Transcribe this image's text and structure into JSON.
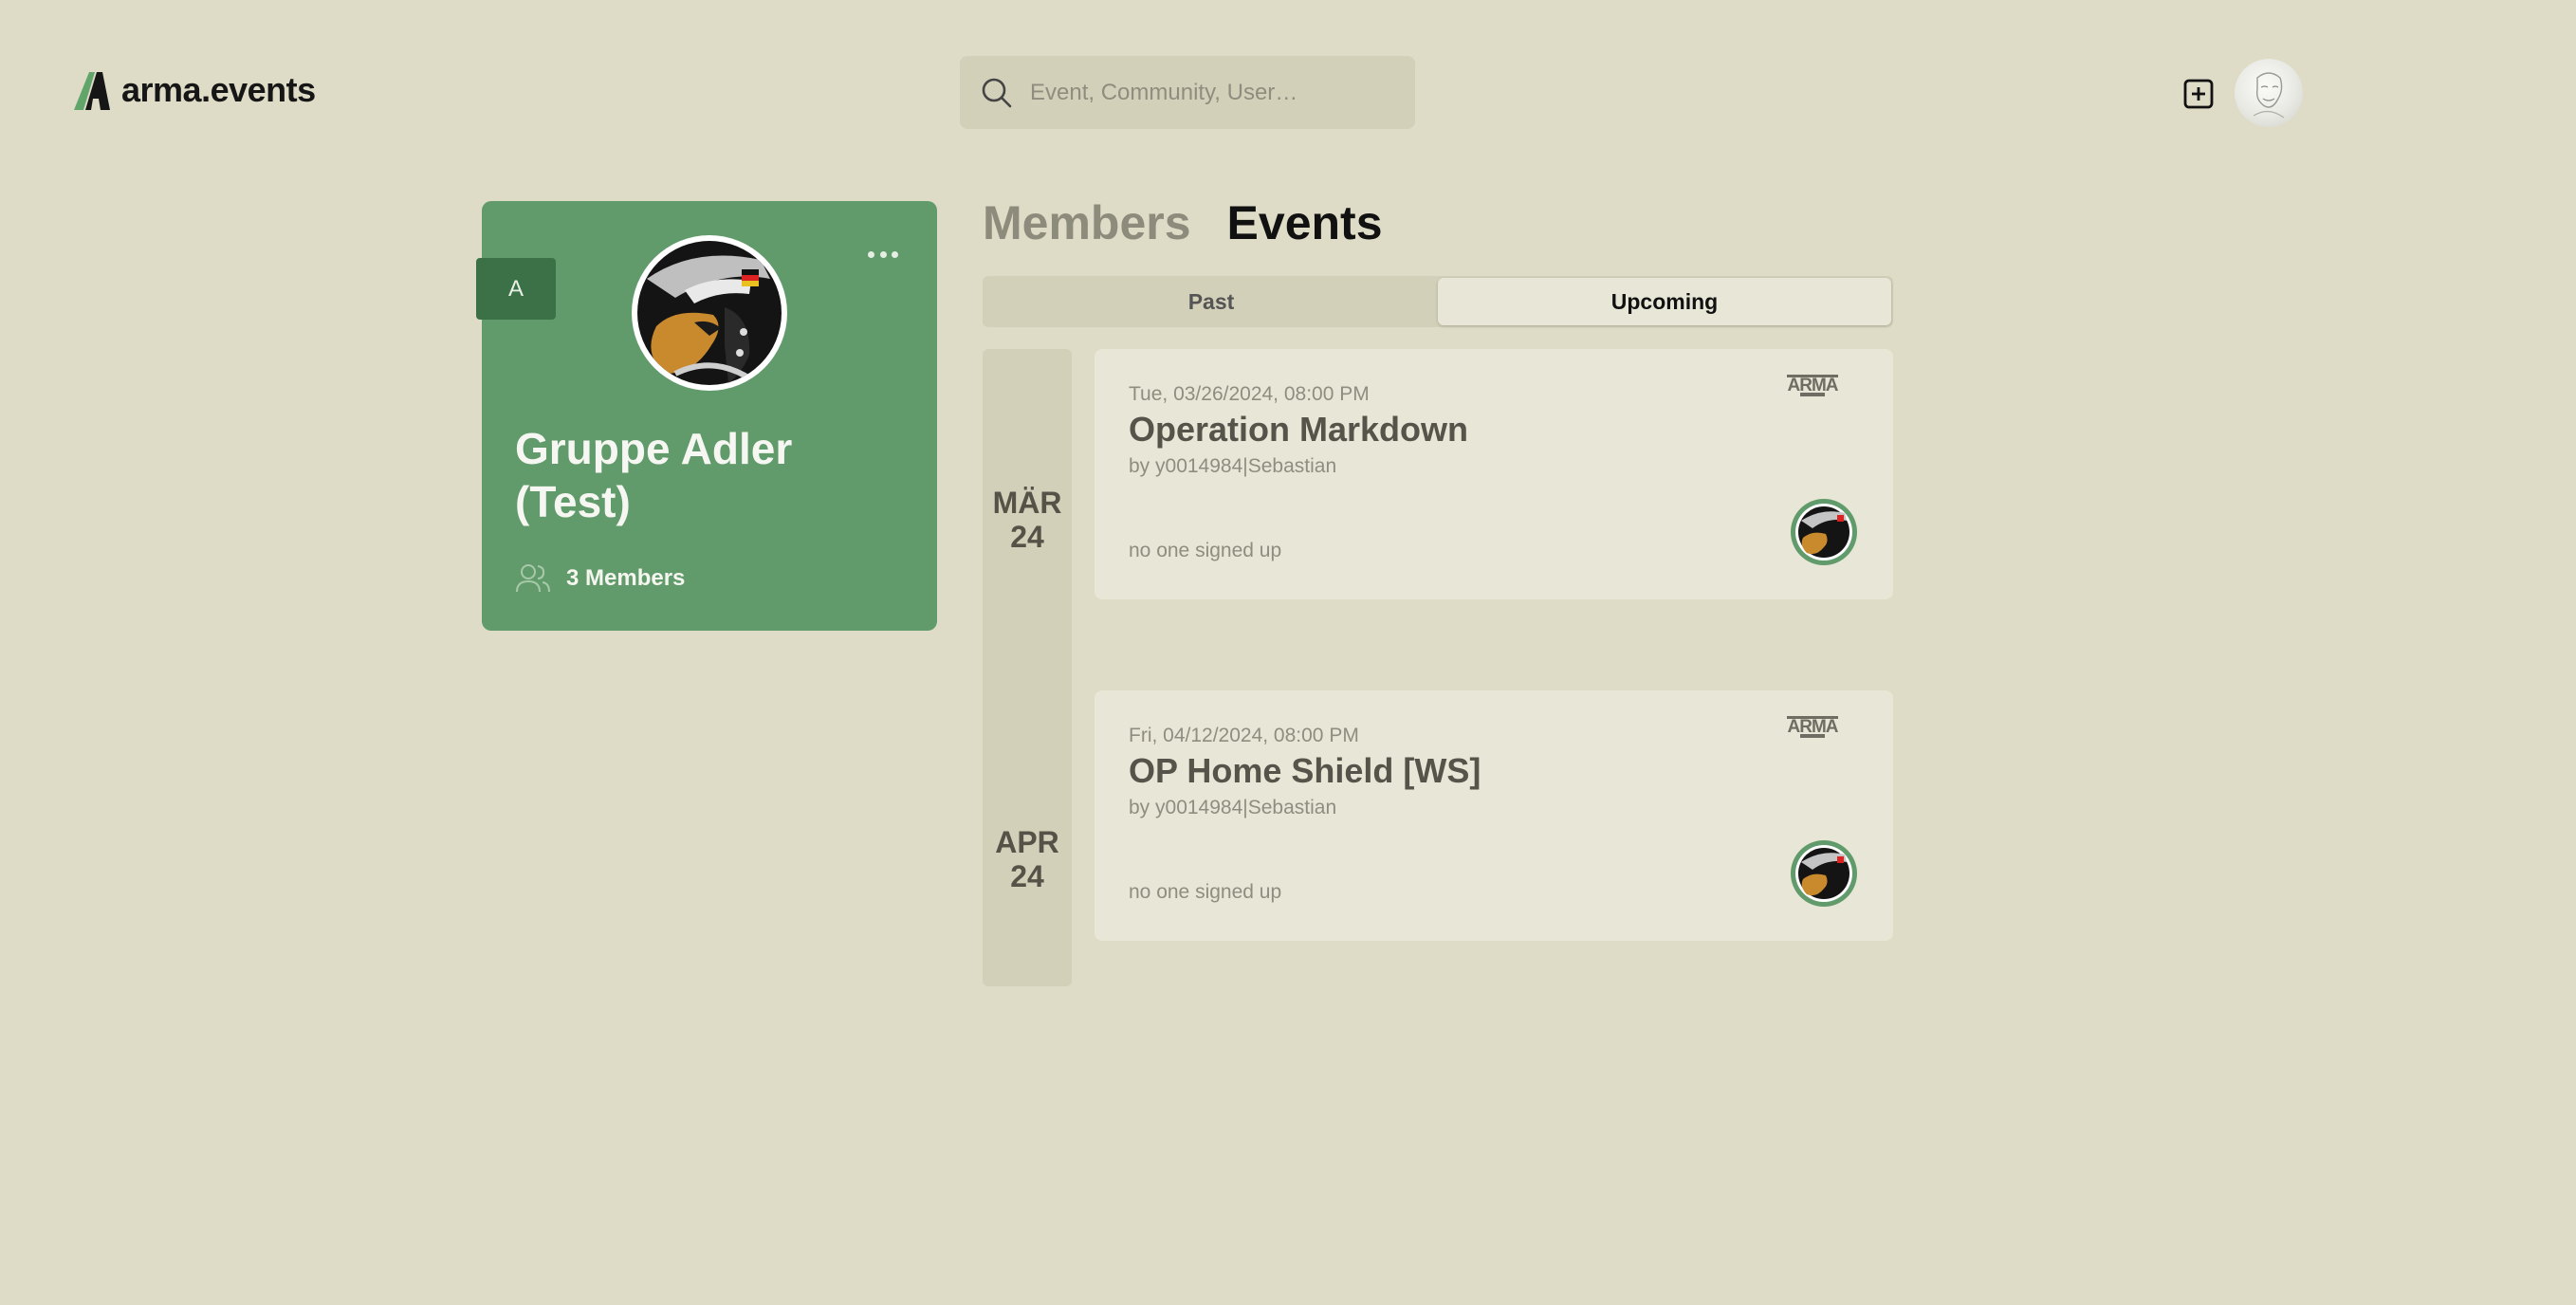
{
  "header": {
    "logo_text": "arma.events",
    "search_placeholder": "Event, Community, User…"
  },
  "group": {
    "badge": "A",
    "name": "Gruppe Adler (Test)",
    "members_label": "3 Members"
  },
  "tabs": {
    "members": "Members",
    "events": "Events",
    "active": "Events"
  },
  "segment": {
    "past": "Past",
    "upcoming": "Upcoming",
    "active": "Upcoming"
  },
  "events": [
    {
      "month": "MÄR",
      "year": "24",
      "date": "Tue, 03/26/2024, 08:00 PM",
      "title": "Operation Markdown",
      "author": "by y0014984|Sebastian",
      "signup": "no one signed up"
    },
    {
      "month": "APR",
      "year": "24",
      "date": "Fri, 04/12/2024, 08:00 PM",
      "title": "OP Home Shield [WS]",
      "author": "by y0014984|Sebastian",
      "signup": "no one signed up"
    }
  ],
  "colors": {
    "background": "#dedbc6",
    "card_green": "#629b6b",
    "badge_green": "#3c7147",
    "panel": "#e8e6d6"
  },
  "icons": {
    "logo": "arma-events-logo-icon",
    "search": "search-icon",
    "add": "plus-square-icon",
    "more": "more-horizontal-icon",
    "members": "users-icon",
    "game": "arma-logo-icon",
    "group": "eagle-emblem-icon"
  }
}
